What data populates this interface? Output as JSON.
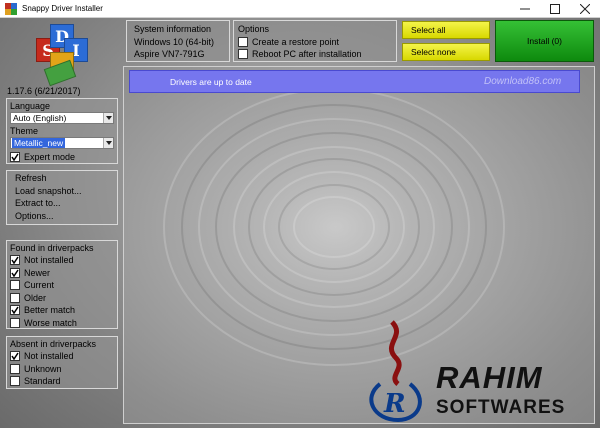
{
  "window": {
    "title": "Snappy Driver Installer"
  },
  "app": {
    "version": "1.17.6 (6/21/2017)",
    "logo_letters": [
      "S",
      "D",
      "I"
    ]
  },
  "system_info": {
    "heading": "System information",
    "os": "Windows 10 (64-bit)",
    "machine": "Aspire VN7-791G"
  },
  "options": {
    "heading": "Options",
    "items": [
      {
        "label": "Create a restore point",
        "checked": false
      },
      {
        "label": "Reboot PC after installation",
        "checked": false
      }
    ]
  },
  "actions": {
    "select_all": "Select all",
    "select_none": "Select none",
    "install": "Install (0)"
  },
  "language": {
    "label": "Language",
    "value": "Auto (English)"
  },
  "theme": {
    "label": "Theme",
    "value": "Metallic_new"
  },
  "expert_mode": {
    "label": "Expert mode",
    "checked": true
  },
  "menu": [
    "Refresh",
    "Load snapshot...",
    "Extract to...",
    "Options..."
  ],
  "found": {
    "heading": "Found in driverpacks",
    "items": [
      {
        "label": "Not installed",
        "checked": true
      },
      {
        "label": "Newer",
        "checked": true
      },
      {
        "label": "Current",
        "checked": false
      },
      {
        "label": "Older",
        "checked": false
      },
      {
        "label": "Better match",
        "checked": true
      },
      {
        "label": "Worse match",
        "checked": false
      }
    ]
  },
  "absent": {
    "heading": "Absent in driverpacks",
    "items": [
      {
        "label": "Not installed",
        "checked": true
      },
      {
        "label": "Unknown",
        "checked": false
      },
      {
        "label": "Standard",
        "checked": false
      }
    ]
  },
  "status": "Drivers are up to date",
  "watermark": {
    "small": "Download86.com",
    "main": "RAHIM",
    "sub": "SOFTWARES",
    "r_letter": "R"
  },
  "colors": {
    "status_bar": "#7676ee",
    "select_buttons": "#e8e820",
    "install_button": "#1aa01a",
    "selection": "#3366dd"
  }
}
